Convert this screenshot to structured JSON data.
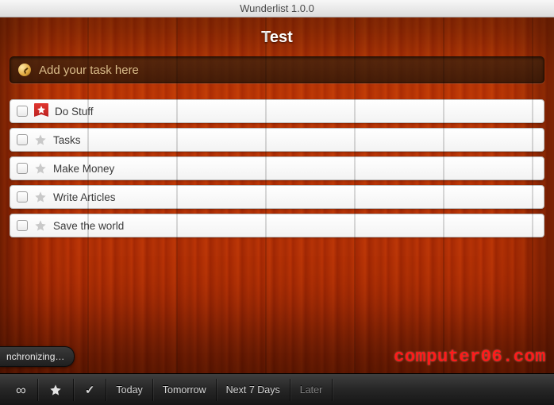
{
  "window": {
    "title": "Wunderlist 1.0.0"
  },
  "list": {
    "title": "Test"
  },
  "addTask": {
    "placeholder": "Add your task here"
  },
  "tasks": [
    {
      "label": "Do Stuff",
      "starred": true
    },
    {
      "label": "Tasks",
      "starred": false
    },
    {
      "label": "Make Money",
      "starred": false
    },
    {
      "label": "Write Articles",
      "starred": false
    },
    {
      "label": "Save the world",
      "starred": false
    }
  ],
  "sync": {
    "label": "nchronizing…"
  },
  "bottombar": {
    "filters": {
      "all_icon": "∞",
      "starred_icon": "★",
      "done_icon": "✓"
    },
    "items": [
      {
        "label": "Today"
      },
      {
        "label": "Tomorrow"
      },
      {
        "label": "Next 7 Days"
      },
      {
        "label": "Later"
      }
    ]
  },
  "watermark": "computer06.com"
}
